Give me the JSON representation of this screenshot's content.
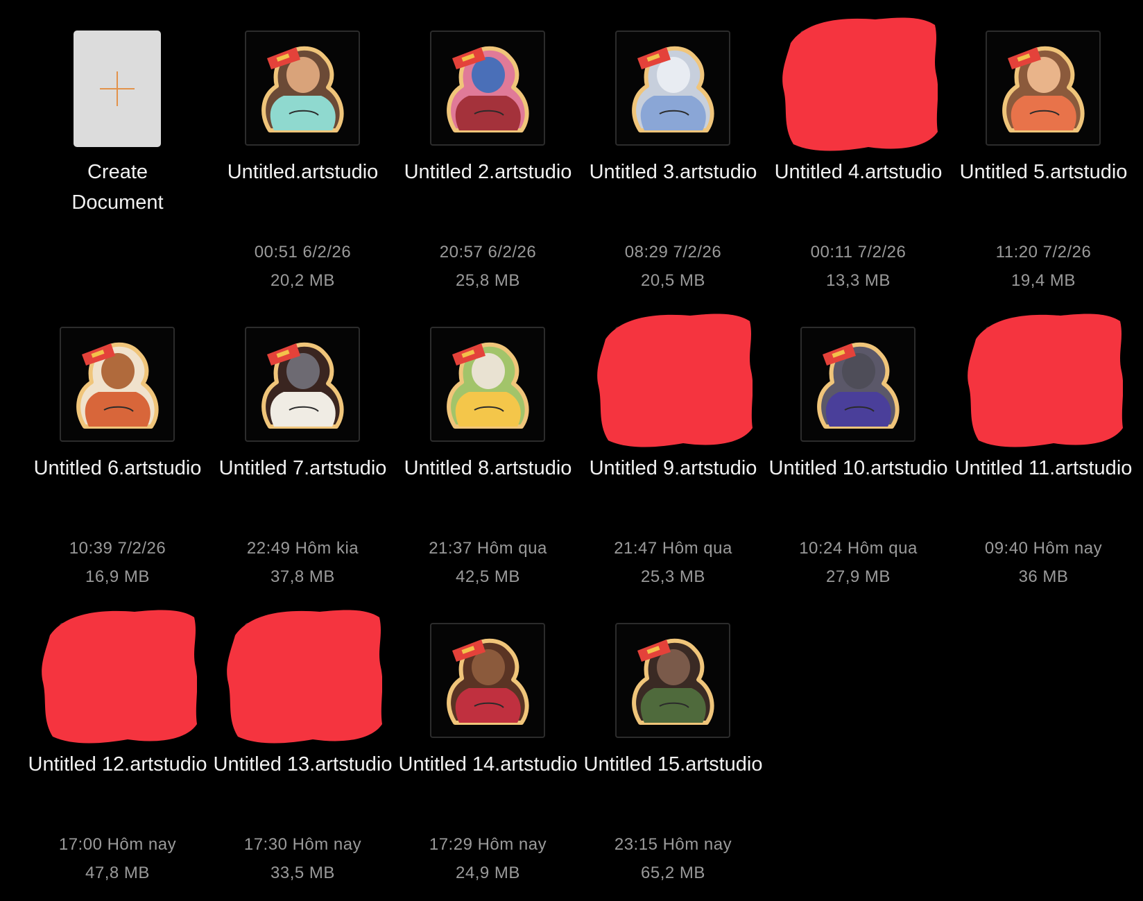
{
  "create": {
    "label_line1": "Create",
    "label_line2": "Document"
  },
  "documents": [
    {
      "name": "Untitled.artstudio",
      "date": "00:51 6/2/26",
      "size": "20,2 MB",
      "thumb": "sticker-teal-girl",
      "redacted": false
    },
    {
      "name": "Untitled 2.artstudio",
      "date": "20:57 6/2/26",
      "size": "25,8 MB",
      "thumb": "sticker-blue-mermaid",
      "redacted": false
    },
    {
      "name": "Untitled 3.artstudio",
      "date": "08:29 7/2/26",
      "size": "20,5 MB",
      "thumb": "sticker-white-tiger",
      "redacted": false
    },
    {
      "name": "Untitled 4.artstudio",
      "date": "00:11 7/2/26",
      "size": "13,3 MB",
      "thumb": "sticker-hidden",
      "redacted": true
    },
    {
      "name": "Untitled 5.artstudio",
      "date": "11:20 7/2/26",
      "size": "19,4 MB",
      "thumb": "sticker-pig",
      "redacted": false
    },
    {
      "name": "Untitled 6.artstudio",
      "date": "10:39 7/2/26",
      "size": "16,9 MB",
      "thumb": "sticker-hamster",
      "redacted": false
    },
    {
      "name": "Untitled 7.artstudio",
      "date": "22:49 Hôm kia",
      "size": "37,8 MB",
      "thumb": "sticker-dark-hair",
      "redacted": false
    },
    {
      "name": "Untitled 8.artstudio",
      "date": "21:37 Hôm qua",
      "size": "42,5 MB",
      "thumb": "sticker-yellow-rabbit",
      "redacted": false
    },
    {
      "name": "Untitled 9.artstudio",
      "date": "21:47 Hôm qua",
      "size": "25,3 MB",
      "thumb": "sticker-hidden",
      "redacted": true
    },
    {
      "name": "Untitled 10.artstudio",
      "date": "10:24 Hôm qua",
      "size": "27,9 MB",
      "thumb": "sticker-purple-wolf",
      "redacted": false
    },
    {
      "name": "Untitled 11.artstudio",
      "date": "09:40 Hôm nay",
      "size": "36 MB",
      "thumb": "sticker-hidden",
      "redacted": true
    },
    {
      "name": "Untitled 12.artstudio",
      "date": "17:00 Hôm nay",
      "size": "47,8 MB",
      "thumb": "sticker-hidden",
      "redacted": true
    },
    {
      "name": "Untitled 13.artstudio",
      "date": "17:30 Hôm nay",
      "size": "33,5 MB",
      "thumb": "sticker-hidden",
      "redacted": true
    },
    {
      "name": "Untitled 14.artstudio",
      "date": "17:29 Hôm nay",
      "size": "24,9 MB",
      "thumb": "sticker-red-buffalo",
      "redacted": false
    },
    {
      "name": "Untitled 15.artstudio",
      "date": "23:15 Hôm nay",
      "size": "65,2 MB",
      "thumb": "sticker-green-boar",
      "redacted": false
    }
  ],
  "colors": {
    "background": "#000000",
    "name_text": "#f2f2f2",
    "meta_text": "#9a9a9a",
    "create_card": "#dcdcdc",
    "plus_accent": "#e2924a",
    "redaction": "#f5343f",
    "sticker_outline": "#f0c57a",
    "banner": "#e4423a"
  }
}
